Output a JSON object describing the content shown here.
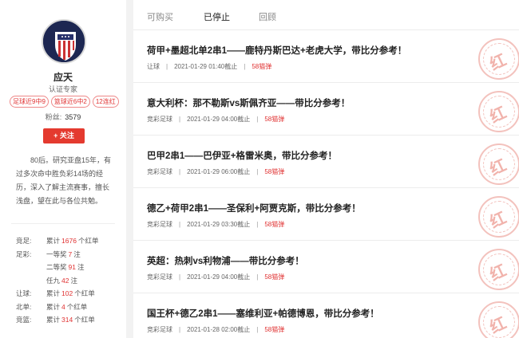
{
  "profile": {
    "name": "应天",
    "cert": "认证专家",
    "tags": [
      "足球近9中9",
      "篮球近6中2",
      "12连红"
    ],
    "fans_label": "粉丝:",
    "fans_count": "3579",
    "follow_label": "+ 关注",
    "bio": "80后。研究亚盘15年，有过多次命中胜负彩14场的经历，深入了解主流赛事，擅长浅盘，望在此与各位共勉。"
  },
  "stats": [
    {
      "label": "竞足:",
      "pre": "累计",
      "num": "1676",
      "post": "个红单"
    },
    {
      "label": "足彩:",
      "pre": "一等奖",
      "num": "7",
      "post": "注"
    },
    {
      "label": "",
      "pre": "二等奖",
      "num": "91",
      "post": "注"
    },
    {
      "label": "",
      "pre": "任九",
      "num": "42",
      "post": "注"
    },
    {
      "label": "让球:",
      "pre": "累计",
      "num": "102",
      "post": "个红单"
    },
    {
      "label": "北单:",
      "pre": "累计",
      "num": "4",
      "post": "个红单"
    },
    {
      "label": "竞篮:",
      "pre": "累计",
      "num": "314",
      "post": "个红单"
    }
  ],
  "tabs": [
    "可购买",
    "已停止",
    "回顾"
  ],
  "stamp_text": "红",
  "items": [
    {
      "title": "荷甲+墨超北单2串1——鹿特丹斯巴达+老虎大学，带比分参考！",
      "type": "让球",
      "time": "2021-01-29 01:40截止",
      "price": "58猫弹"
    },
    {
      "title": "意大利杯：那不勒斯vs斯佩齐亚——带比分参考！",
      "type": "竞彩足球",
      "time": "2021-01-29 04:00截止",
      "price": "58猫弹"
    },
    {
      "title": "巴甲2串1——巴伊亚+格雷米奥，带比分参考！",
      "type": "竞彩足球",
      "time": "2021-01-29 06:00截止",
      "price": "58猫弹"
    },
    {
      "title": "德乙+荷甲2串1——圣保利+阿贾克斯，带比分参考！",
      "type": "竞彩足球",
      "time": "2021-01-29 03:30截止",
      "price": "58猫弹"
    },
    {
      "title": "英超：热刺vs利物浦——带比分参考！",
      "type": "竞彩足球",
      "time": "2021-01-29 04:00截止",
      "price": "58猫弹"
    },
    {
      "title": "国王杯+德乙2串1——塞维利亚+帕德博恩，带比分参考！",
      "type": "竞彩足球",
      "time": "2021-01-28 02:00截止",
      "price": "58猫弹"
    }
  ]
}
